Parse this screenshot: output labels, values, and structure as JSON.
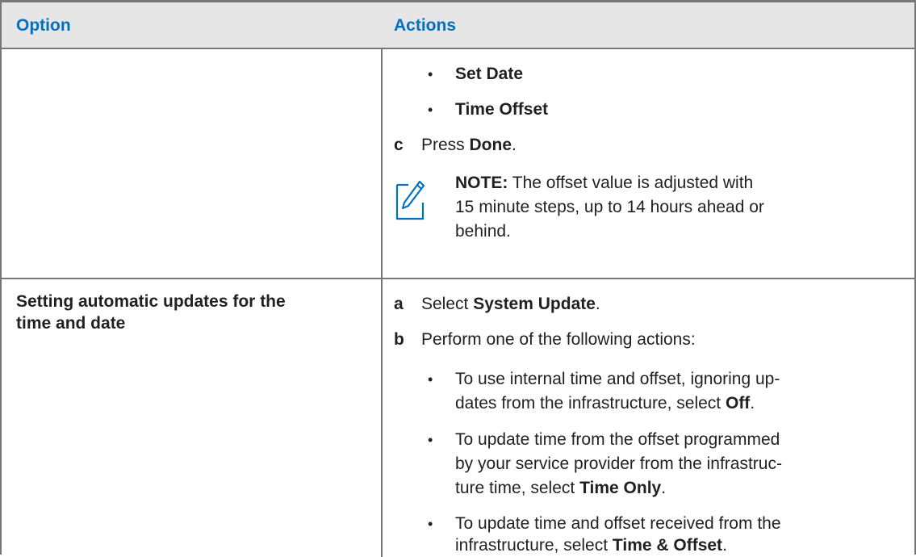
{
  "header": {
    "option": "Option",
    "actions": "Actions"
  },
  "row1": {
    "bullets": [
      "Set Date",
      "Time Offset"
    ],
    "step_c": {
      "label": "c",
      "pre": "Press ",
      "bold": "Done",
      "post": "."
    },
    "note": {
      "title": "NOTE:",
      "line1": " The offset value is adjusted with",
      "line2": "15 minute steps, up to 14 hours ahead or",
      "line3": "behind."
    }
  },
  "row2": {
    "option_line1": "Setting automatic updates for the",
    "option_line2": "time and date",
    "step_a": {
      "label": "a",
      "pre": "Select ",
      "bold": "System Update",
      "post": "."
    },
    "step_b": {
      "label": "b",
      "text": "Perform one of the following actions:"
    },
    "actions": [
      {
        "line1": "To use internal time and offset, ignoring up-",
        "line2_pre": "dates from the infrastructure, select ",
        "bold": "Off",
        "post": "."
      },
      {
        "line1": "To update time from the offset programmed",
        "line2": "by your service provider from the infrastruc-",
        "line3_pre": "ture time, select ",
        "bold": "Time Only",
        "post": "."
      },
      {
        "line1": "To update time and offset received from the",
        "line2_pre": "infrastructure, select ",
        "bold": "Time & Offset",
        "post": "."
      }
    ]
  },
  "icons": {
    "note": "note-pencil-icon"
  }
}
